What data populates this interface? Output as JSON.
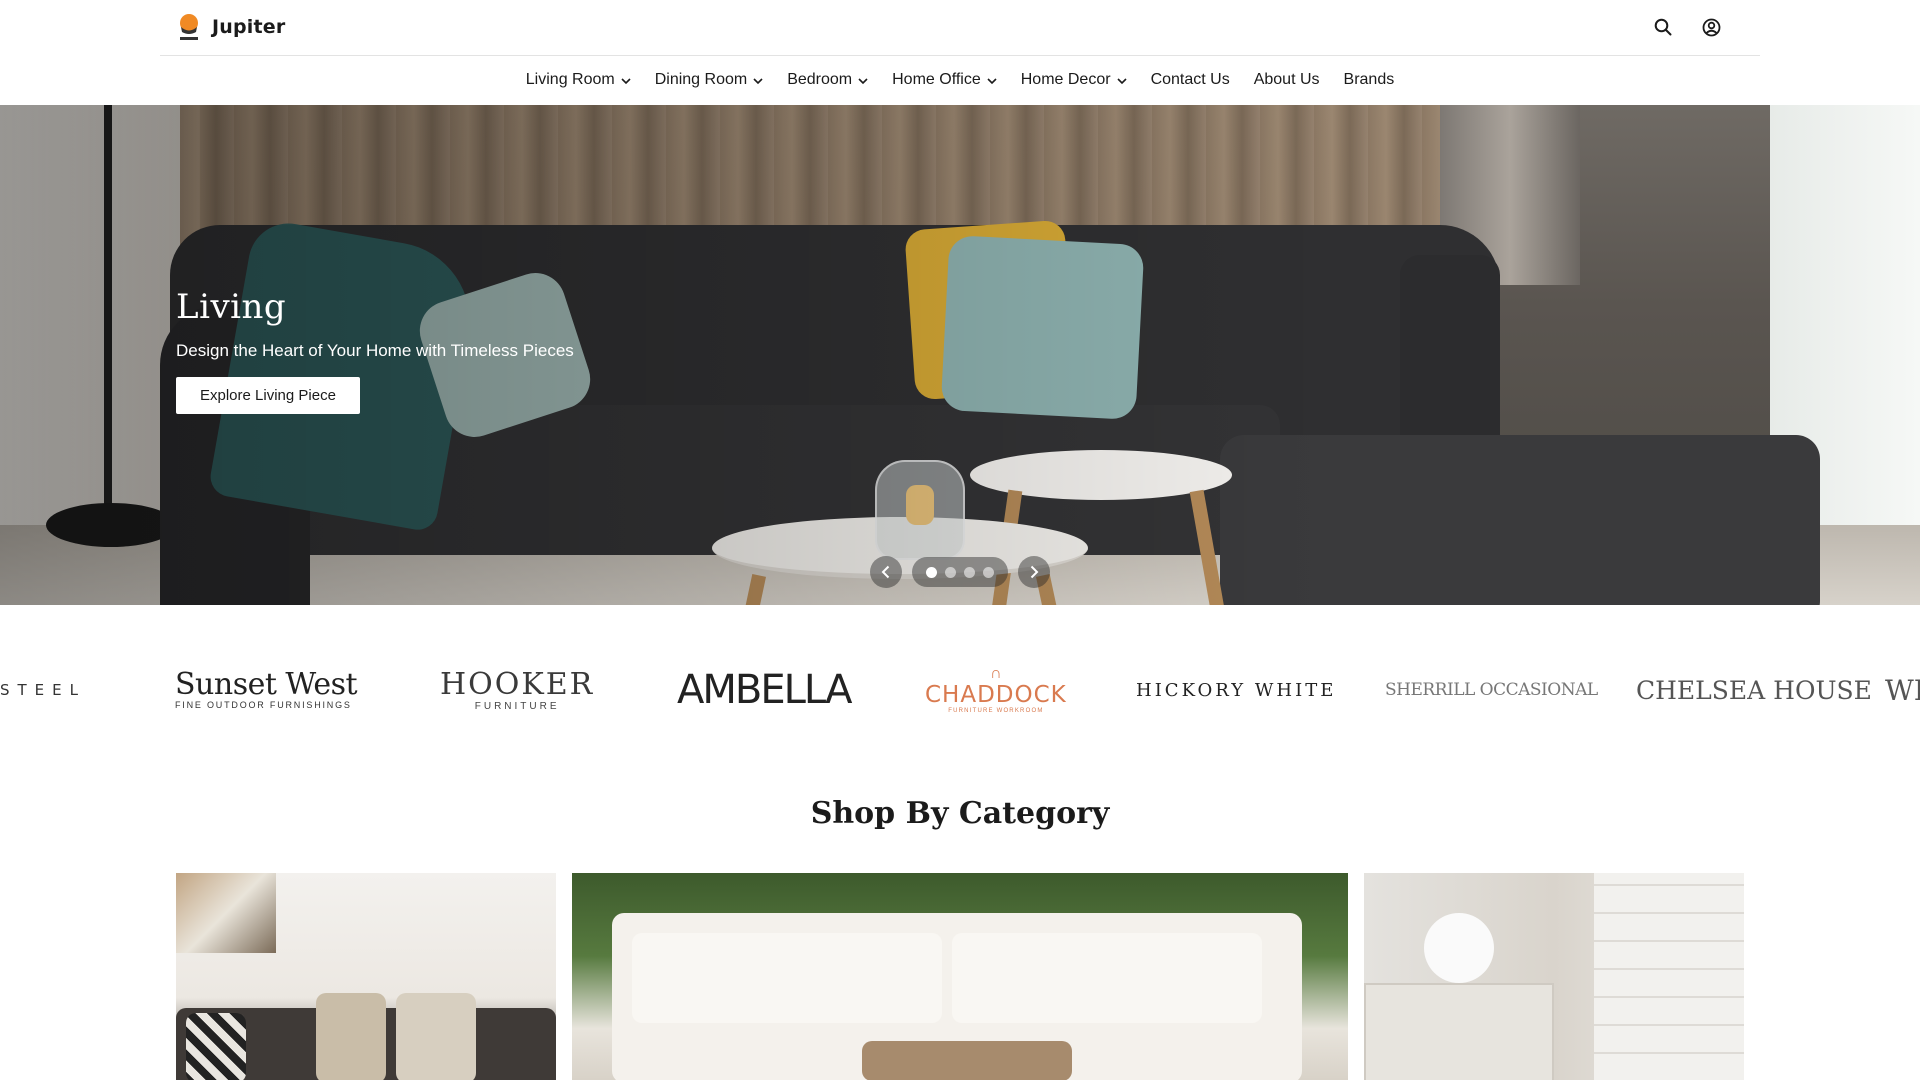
{
  "brand": {
    "name": "Jupiter"
  },
  "nav": {
    "items": [
      {
        "label": "Living Room",
        "dropdown": true
      },
      {
        "label": "Dining Room",
        "dropdown": true
      },
      {
        "label": "Bedroom",
        "dropdown": true
      },
      {
        "label": "Home Office",
        "dropdown": true
      },
      {
        "label": "Home Decor",
        "dropdown": true
      },
      {
        "label": "Contact Us",
        "dropdown": false
      },
      {
        "label": "About Us",
        "dropdown": false
      },
      {
        "label": "Brands",
        "dropdown": false
      }
    ]
  },
  "header_icons": [
    "search-icon",
    "account-icon"
  ],
  "hero": {
    "title": "Living",
    "subtitle": "Design the Heart of Your Home with Timeless Pieces",
    "cta": "Explore Living Piece",
    "slide_count": 4,
    "active_slide": 1
  },
  "brands_strip": {
    "steel": "STEEL",
    "sunset_west": {
      "name": "Sunset West",
      "tagline": "FINE OUTDOOR FURNISHINGS"
    },
    "hooker": {
      "name": "HOOKER",
      "tagline": "FURNITURE"
    },
    "ambella": "AMBELLA",
    "chaddock": {
      "name": "CHADDOCK",
      "tagline": "FURNITURE WORKROOM"
    },
    "hickory_white": "HICKORY WHITE",
    "sherrill": "SHERRILL OCCASIONAL",
    "chelsea_house": "CHELSEA HOUSE",
    "partial": "WI"
  },
  "categories": {
    "title": "Shop By Category"
  },
  "colors": {
    "text": "#1b1b1b",
    "chaddock_accent": "#d97a4f",
    "logo_accent": "#f08a24"
  }
}
